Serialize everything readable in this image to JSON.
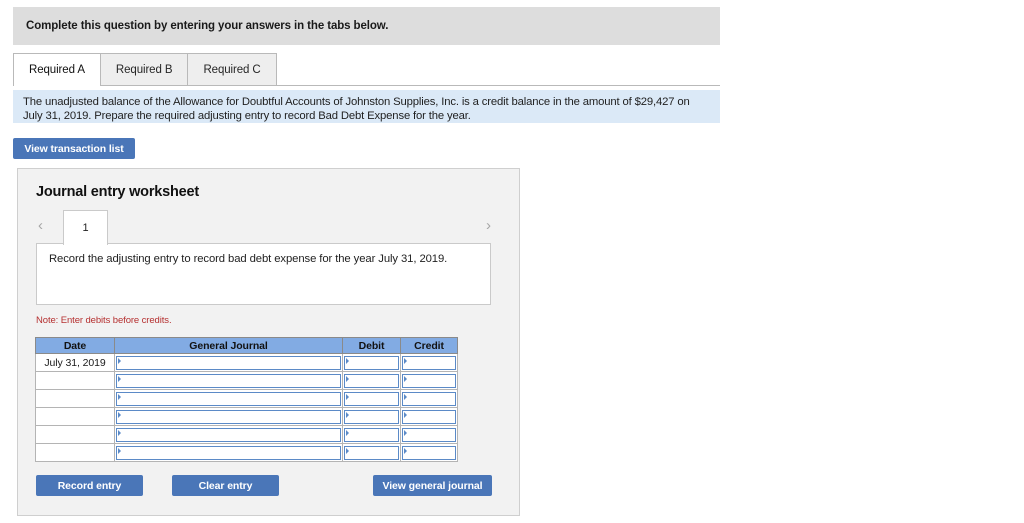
{
  "instruction": {
    "text": "Complete this question by entering your answers in the tabs below."
  },
  "tabs": [
    {
      "label": "Required A",
      "active": true
    },
    {
      "label": "Required B",
      "active": false
    },
    {
      "label": "Required C",
      "active": false
    }
  ],
  "question": {
    "text": "The unadjusted balance of the Allowance for Doubtful Accounts of Johnston Supplies, Inc. is a credit balance in the amount of $29,427 on July 31, 2019. Prepare the required adjusting entry to record Bad Debt Expense for the year."
  },
  "actions": {
    "view_transaction_list": "View transaction list",
    "record_entry": "Record entry",
    "clear_entry": "Clear entry",
    "view_general_journal": "View general journal"
  },
  "worksheet": {
    "title": "Journal entry worksheet",
    "pager": {
      "prev_icon": "‹",
      "next_icon": "›",
      "pages": [
        "1"
      ],
      "current": "1"
    },
    "description": "Record the adjusting entry to record bad debt expense for the year July 31, 2019.",
    "note": "Note: Enter debits before credits.",
    "table": {
      "headers": [
        "Date",
        "General Journal",
        "Debit",
        "Credit"
      ],
      "rows": [
        {
          "date": "July 31, 2019",
          "journal": "",
          "debit": "",
          "credit": ""
        },
        {
          "date": "",
          "journal": "",
          "debit": "",
          "credit": ""
        },
        {
          "date": "",
          "journal": "",
          "debit": "",
          "credit": ""
        },
        {
          "date": "",
          "journal": "",
          "debit": "",
          "credit": ""
        },
        {
          "date": "",
          "journal": "",
          "debit": "",
          "credit": ""
        },
        {
          "date": "",
          "journal": "",
          "debit": "",
          "credit": ""
        }
      ]
    }
  },
  "colors": {
    "banner_gray": "#dddddd",
    "question_blue": "#dbe9f7",
    "button_blue": "#4a76b8",
    "table_header_blue": "#82abe3",
    "note_red": "#b53030",
    "panel_gray": "#f2f2f2"
  }
}
